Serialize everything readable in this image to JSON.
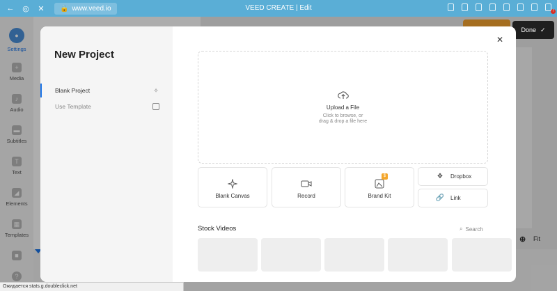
{
  "browser": {
    "url": "www.veed.io",
    "title": "VEED CREATE | Edit"
  },
  "leftnav": {
    "items": [
      {
        "label": "Settings",
        "icon": "settings-icon"
      },
      {
        "label": "Media",
        "icon": "plus-icon"
      },
      {
        "label": "Audio",
        "icon": "music-icon"
      },
      {
        "label": "Subtitles",
        "icon": "subtitles-icon"
      },
      {
        "label": "Text",
        "icon": "text-icon"
      },
      {
        "label": "Elements",
        "icon": "elements-icon"
      },
      {
        "label": "Templates",
        "icon": "templates-icon"
      }
    ]
  },
  "editor": {
    "done_label": "Done",
    "zoom_label": "Fit"
  },
  "modal": {
    "title": "New Project",
    "options": [
      {
        "label": "Blank Project",
        "icon": "sparkle-icon"
      },
      {
        "label": "Use Template",
        "icon": "template-icon"
      }
    ],
    "upload": {
      "title": "Upload a File",
      "sub1": "Click to browse, or",
      "sub2": "drag & drop a file here"
    },
    "tiles": [
      {
        "label": "Blank Canvas",
        "icon": "sparkle-icon"
      },
      {
        "label": "Record",
        "icon": "record-icon"
      },
      {
        "label": "Brand Kit",
        "icon": "brand-kit-icon",
        "badge": "$"
      }
    ],
    "mini": [
      {
        "label": "Dropbox",
        "icon": "dropbox-icon"
      },
      {
        "label": "Link",
        "icon": "link-icon"
      }
    ],
    "stock": {
      "heading": "Stock Videos",
      "search": "Search"
    }
  },
  "status": "Ожидается stats.g.doubleclick.net"
}
